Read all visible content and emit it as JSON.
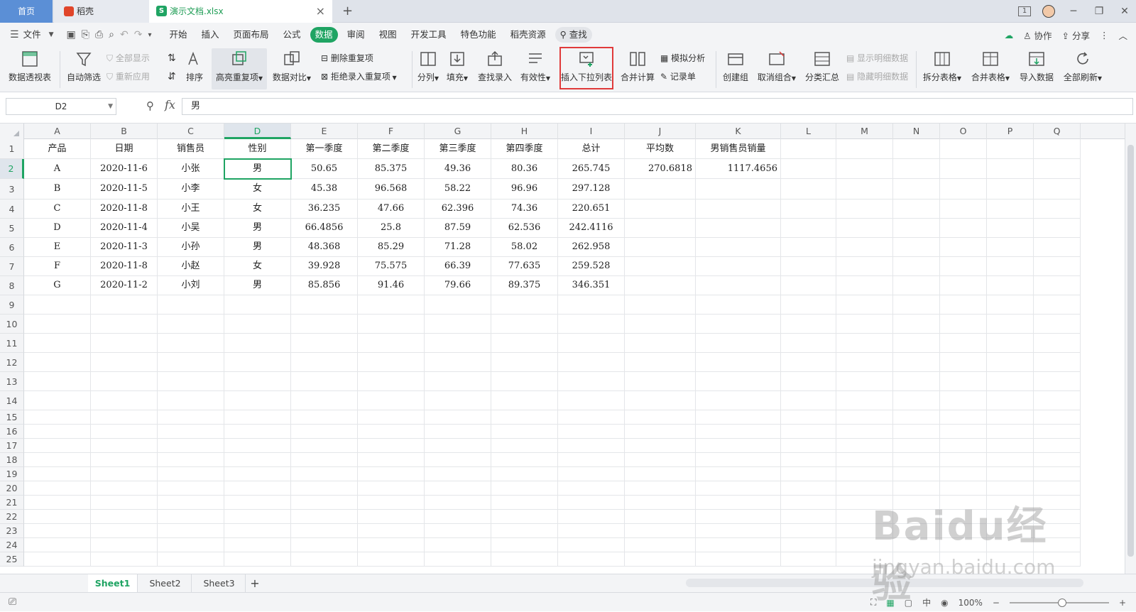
{
  "tabs": {
    "home": "首页",
    "daoke": "稻壳",
    "doc": "演示文档.xlsx",
    "close": "×",
    "new": "+"
  },
  "window": {
    "minimize": "─",
    "restore": "❐",
    "close": "✕",
    "badge": "1"
  },
  "menu": {
    "file": "文件",
    "items": [
      "开始",
      "插入",
      "页面布局",
      "公式",
      "数据",
      "审阅",
      "视图",
      "开发工具",
      "特色功能",
      "稻壳资源"
    ],
    "active": "数据",
    "search": "查找",
    "collab": "协作",
    "share": "分享"
  },
  "ribbon": {
    "pivot": "数据透视表",
    "autofilter": "自动筛选",
    "showall": "全部显示",
    "reapply": "重新应用",
    "sort": "排序",
    "highlight_dup": "高亮重复项",
    "compare": "数据对比",
    "remove_dup": "删除重复项",
    "reject_dup": "拒绝录入重复项",
    "split": "分列",
    "fill": "填充",
    "lookup": "查找录入",
    "validity": "有效性",
    "insert_dropdown": "插入下拉列表",
    "consolidate": "合并计算",
    "whatif": "模拟分析",
    "record": "记录单",
    "group": "创建组",
    "ungroup": "取消组合",
    "subtotal": "分类汇总",
    "show_detail": "显示明细数据",
    "hide_detail": "隐藏明细数据",
    "split_table": "拆分表格",
    "merge_table": "合并表格",
    "import": "导入数据",
    "refresh_all": "全部刷新"
  },
  "formula_bar": {
    "name_box": "D2",
    "fx": "fx",
    "value": "男"
  },
  "grid": {
    "columns": [
      "A",
      "B",
      "C",
      "D",
      "E",
      "F",
      "G",
      "H",
      "I",
      "J",
      "K",
      "L",
      "M",
      "N",
      "O",
      "P",
      "Q"
    ],
    "selected_cell": "D2",
    "header_row": [
      "产品",
      "日期",
      "销售员",
      "性别",
      "第一季度",
      "第二季度",
      "第三季度",
      "第四季度",
      "总计",
      "平均数",
      "男销售员销量"
    ],
    "rows": [
      [
        "A",
        "2020-11-6",
        "小张",
        "男",
        "50.65",
        "85.375",
        "49.36",
        "80.36",
        "265.745",
        "270.6818",
        "1117.4656"
      ],
      [
        "B",
        "2020-11-5",
        "小李",
        "女",
        "45.38",
        "96.568",
        "58.22",
        "96.96",
        "297.128",
        "",
        ""
      ],
      [
        "C",
        "2020-11-8",
        "小王",
        "女",
        "36.235",
        "47.66",
        "62.396",
        "74.36",
        "220.651",
        "",
        ""
      ],
      [
        "D",
        "2020-11-4",
        "小吴",
        "男",
        "66.4856",
        "25.8",
        "87.59",
        "62.536",
        "242.4116",
        "",
        ""
      ],
      [
        "E",
        "2020-11-3",
        "小孙",
        "男",
        "48.368",
        "85.29",
        "71.28",
        "58.02",
        "262.958",
        "",
        ""
      ],
      [
        "F",
        "2020-11-8",
        "小赵",
        "女",
        "39.928",
        "75.575",
        "66.39",
        "77.635",
        "259.528",
        "",
        ""
      ],
      [
        "G",
        "2020-11-2",
        "小刘",
        "男",
        "85.856",
        "91.46",
        "79.66",
        "89.375",
        "346.351",
        "",
        ""
      ]
    ],
    "row_numbers": [
      "1",
      "2",
      "3",
      "4",
      "5",
      "6",
      "7",
      "8",
      "9",
      "10",
      "11",
      "12",
      "13",
      "14",
      "15",
      "16",
      "17",
      "18",
      "19",
      "20",
      "21",
      "22",
      "23",
      "24",
      "25"
    ]
  },
  "sheets": [
    "Sheet1",
    "Sheet2",
    "Sheet3"
  ],
  "active_sheet": "Sheet1",
  "status": {
    "zoom": "100%",
    "ime": "中"
  },
  "watermark": {
    "main": "Baidu经验",
    "sub": "jingyan.baidu.com"
  },
  "colors": {
    "accent": "#1fa463",
    "highlight_border": "#e03a3a",
    "home_tab": "#5b8fd6"
  }
}
